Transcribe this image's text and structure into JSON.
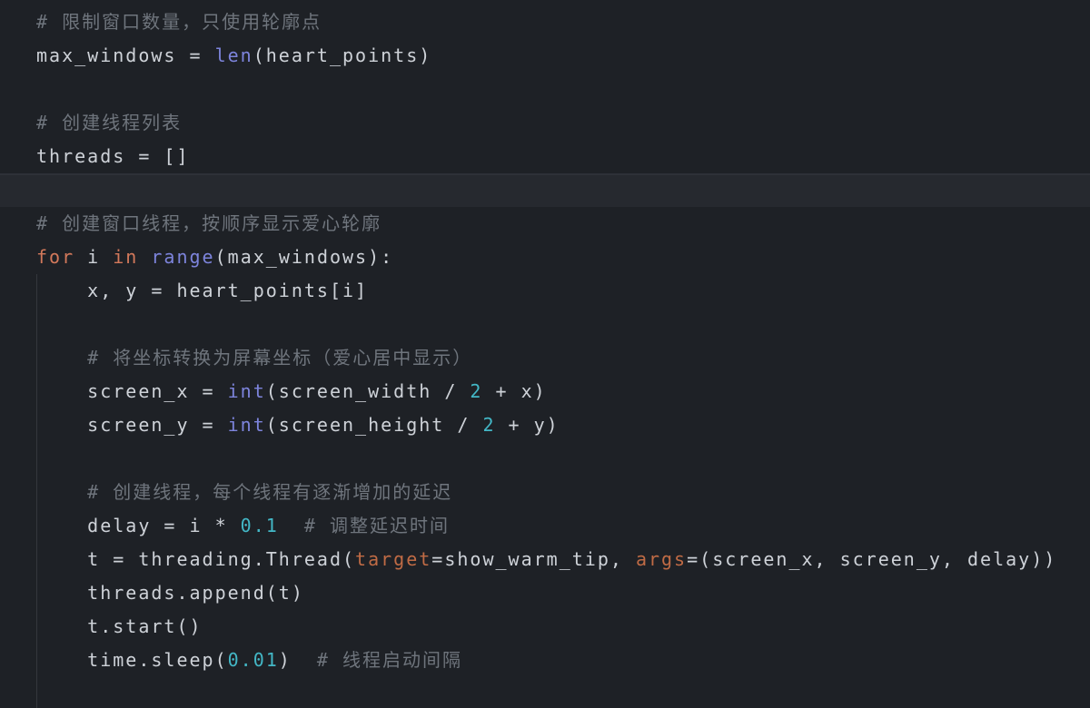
{
  "colors": {
    "background": "#1e2126",
    "current_line_background": "#26292f",
    "current_line_top_edge": "#2e3138",
    "indent_guide": "#34373d",
    "text": "#ced2d8",
    "comment": "#6f757d",
    "keyword": "#d3795b",
    "builtin": "#7d84dc",
    "number": "#43b7c6",
    "argument": "#c06b45"
  },
  "editor": {
    "lines": [
      {
        "tokens": [
          {
            "t": "# 限制窗口数量，只使用轮廓点",
            "c": "comment"
          }
        ]
      },
      {
        "tokens": [
          {
            "t": "max_windows = ",
            "c": "text"
          },
          {
            "t": "len",
            "c": "builtin"
          },
          {
            "t": "(heart_points)",
            "c": "text"
          }
        ]
      },
      {
        "tokens": []
      },
      {
        "tokens": [
          {
            "t": "# 创建线程列表",
            "c": "comment"
          }
        ]
      },
      {
        "tokens": [
          {
            "t": "threads = []",
            "c": "text"
          }
        ]
      },
      {
        "tokens": [],
        "current": true
      },
      {
        "tokens": [
          {
            "t": "# 创建窗口线程，按顺序显示爱心轮廓",
            "c": "comment"
          }
        ]
      },
      {
        "tokens": [
          {
            "t": "for",
            "c": "keyword"
          },
          {
            "t": " i ",
            "c": "text"
          },
          {
            "t": "in",
            "c": "keyword"
          },
          {
            "t": " ",
            "c": "text"
          },
          {
            "t": "range",
            "c": "builtin"
          },
          {
            "t": "(max_windows):",
            "c": "text"
          }
        ]
      },
      {
        "tokens": [
          {
            "t": "    x, y = heart_points[i]",
            "c": "text"
          }
        ]
      },
      {
        "tokens": []
      },
      {
        "tokens": [
          {
            "t": "    ",
            "c": "text"
          },
          {
            "t": "# 将坐标转换为屏幕坐标（爱心居中显示）",
            "c": "comment"
          }
        ]
      },
      {
        "tokens": [
          {
            "t": "    screen_x = ",
            "c": "text"
          },
          {
            "t": "int",
            "c": "builtin"
          },
          {
            "t": "(screen_width / ",
            "c": "text"
          },
          {
            "t": "2",
            "c": "number"
          },
          {
            "t": " + x)",
            "c": "text"
          }
        ]
      },
      {
        "tokens": [
          {
            "t": "    screen_y = ",
            "c": "text"
          },
          {
            "t": "int",
            "c": "builtin"
          },
          {
            "t": "(screen_height / ",
            "c": "text"
          },
          {
            "t": "2",
            "c": "number"
          },
          {
            "t": " + y)",
            "c": "text"
          }
        ]
      },
      {
        "tokens": []
      },
      {
        "tokens": [
          {
            "t": "    ",
            "c": "text"
          },
          {
            "t": "# 创建线程，每个线程有逐渐增加的延迟",
            "c": "comment"
          }
        ]
      },
      {
        "tokens": [
          {
            "t": "    delay = i * ",
            "c": "text"
          },
          {
            "t": "0.1",
            "c": "number"
          },
          {
            "t": "  ",
            "c": "text"
          },
          {
            "t": "# 调整延迟时间",
            "c": "comment"
          }
        ]
      },
      {
        "tokens": [
          {
            "t": "    t = threading.Thread(",
            "c": "text"
          },
          {
            "t": "target",
            "c": "argument"
          },
          {
            "t": "=show_warm_tip, ",
            "c": "text"
          },
          {
            "t": "args",
            "c": "argument"
          },
          {
            "t": "=(screen_x, screen_y, delay))",
            "c": "text"
          }
        ]
      },
      {
        "tokens": [
          {
            "t": "    threads.append(t)",
            "c": "text"
          }
        ]
      },
      {
        "tokens": [
          {
            "t": "    t.start()",
            "c": "text"
          }
        ]
      },
      {
        "tokens": [
          {
            "t": "    time.sleep(",
            "c": "text"
          },
          {
            "t": "0.01",
            "c": "number"
          },
          {
            "t": ")  ",
            "c": "text"
          },
          {
            "t": "# 线程启动间隔",
            "c": "comment"
          }
        ]
      },
      {
        "tokens": []
      }
    ]
  }
}
